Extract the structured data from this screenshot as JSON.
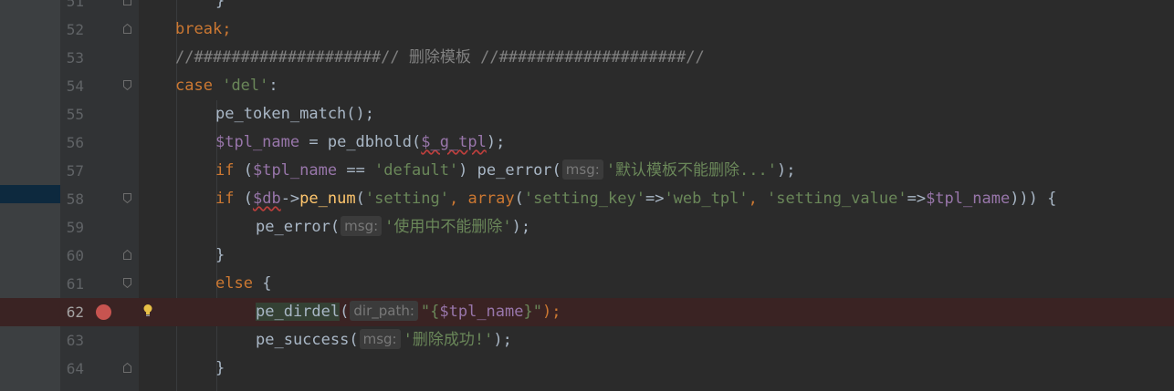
{
  "editor": {
    "lines": [
      {
        "num": "51",
        "text": "}"
      },
      {
        "num": "52",
        "kw": "break",
        "semi": ";"
      },
      {
        "num": "53",
        "comment": "//####################// 删除模板 //####################//"
      },
      {
        "num": "54",
        "kw": "case",
        "str": "'del'",
        "tail": ":"
      },
      {
        "num": "55",
        "fn": "pe_token_match",
        "p1": "();"
      },
      {
        "num": "56",
        "var": "$tpl_name",
        "op": " = ",
        "fn": "pe_dbhold",
        "p1": "(",
        "arg": "$_g_tpl",
        "p2": ");"
      },
      {
        "num": "57",
        "kw": "if",
        "p1": " (",
        "var": "$tpl_name",
        "op": " == ",
        "str": "'default'",
        "p2": ") ",
        "fn": "pe_error",
        "p3": "(",
        "hint": "msg:",
        "arg": "'默认模板不能删除...'",
        "p4": ");"
      },
      {
        "num": "58",
        "kw": "if",
        "p1": " (",
        "var": "$db",
        "arrow": "->",
        "fn": "pe_num",
        "p2": "(",
        "s1": "'setting'",
        "c1": ", ",
        "kw2": "array",
        "p3": "(",
        "s2": "'setting_key'",
        "a1": "=>",
        "s3": "'web_tpl'",
        "c2": ", ",
        "s4": "'setting_value'",
        "a2": "=>",
        "v2": "$tpl_name",
        "p4": "))) {"
      },
      {
        "num": "59",
        "fn": "pe_error",
        "p1": "(",
        "hint": "msg:",
        "arg": "'使用中不能删除'",
        "p2": ");"
      },
      {
        "num": "60",
        "text": "}"
      },
      {
        "num": "61",
        "kw": "else",
        "tail": " {"
      },
      {
        "num": "62",
        "fn": "pe_dirdel",
        "p1": "(",
        "hint": "dir_path:",
        "q1": "\"{",
        "var": "$tpl_name",
        "q2": "}\"",
        "p2": ");"
      },
      {
        "num": "63",
        "fn": "pe_success",
        "p1": "(",
        "hint": "msg:",
        "arg": "'删除成功!'",
        "p2": ");"
      },
      {
        "num": "64",
        "text": "}"
      }
    ]
  },
  "colors": {
    "background": "#2b2b2b",
    "keyword": "#cc7832",
    "string": "#6a8759",
    "variable": "#9876aa",
    "function": "#ffc66d",
    "breakpoint": "#c75450"
  },
  "icons": {
    "breakpoint": "breakpoint-icon",
    "bulb": "lightbulb-icon",
    "fold": "fold-marker-icon"
  }
}
